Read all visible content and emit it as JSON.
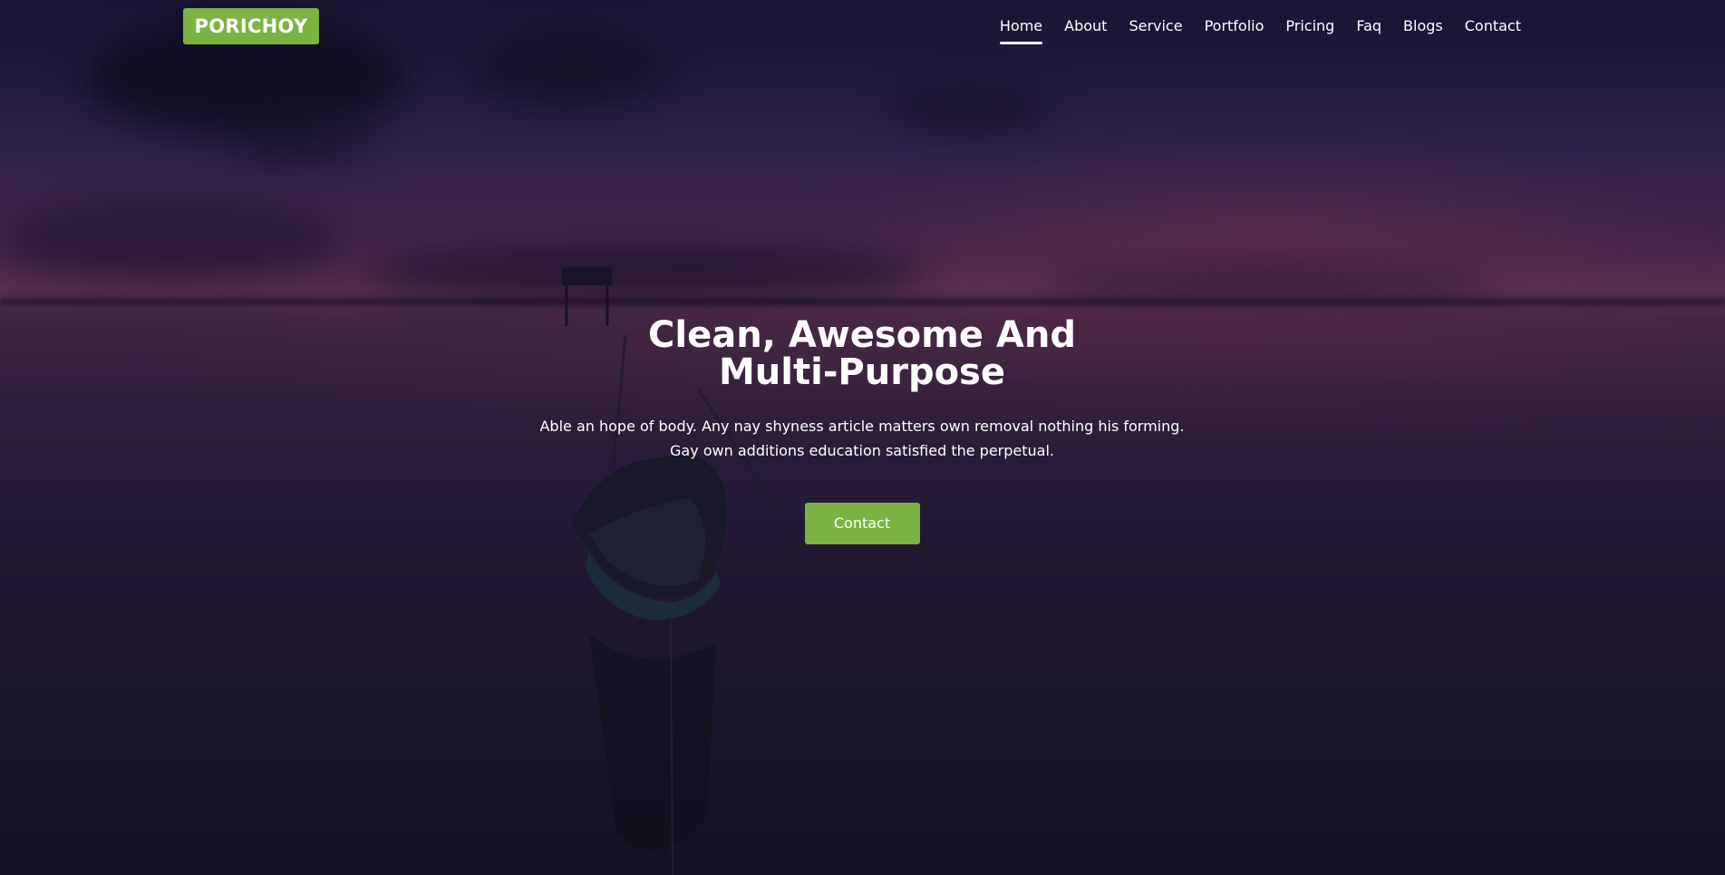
{
  "brand": {
    "logo_text": "PORICHOY"
  },
  "nav": {
    "items": [
      {
        "label": "Home",
        "active": true
      },
      {
        "label": "About"
      },
      {
        "label": "Service"
      },
      {
        "label": "Portfolio"
      },
      {
        "label": "Pricing"
      },
      {
        "label": "Faq"
      },
      {
        "label": "Blogs"
      },
      {
        "label": "Contact"
      }
    ]
  },
  "hero": {
    "title": "Clean, Awesome And Multi-Purpose",
    "subtitle": "Able an hope of body. Any nay shyness article matters own removal nothing his forming. Gay own additions education satisfied the perpetual.",
    "button_label": "Contact"
  },
  "colors": {
    "accent": "#7cb342",
    "text": "#ffffff"
  }
}
